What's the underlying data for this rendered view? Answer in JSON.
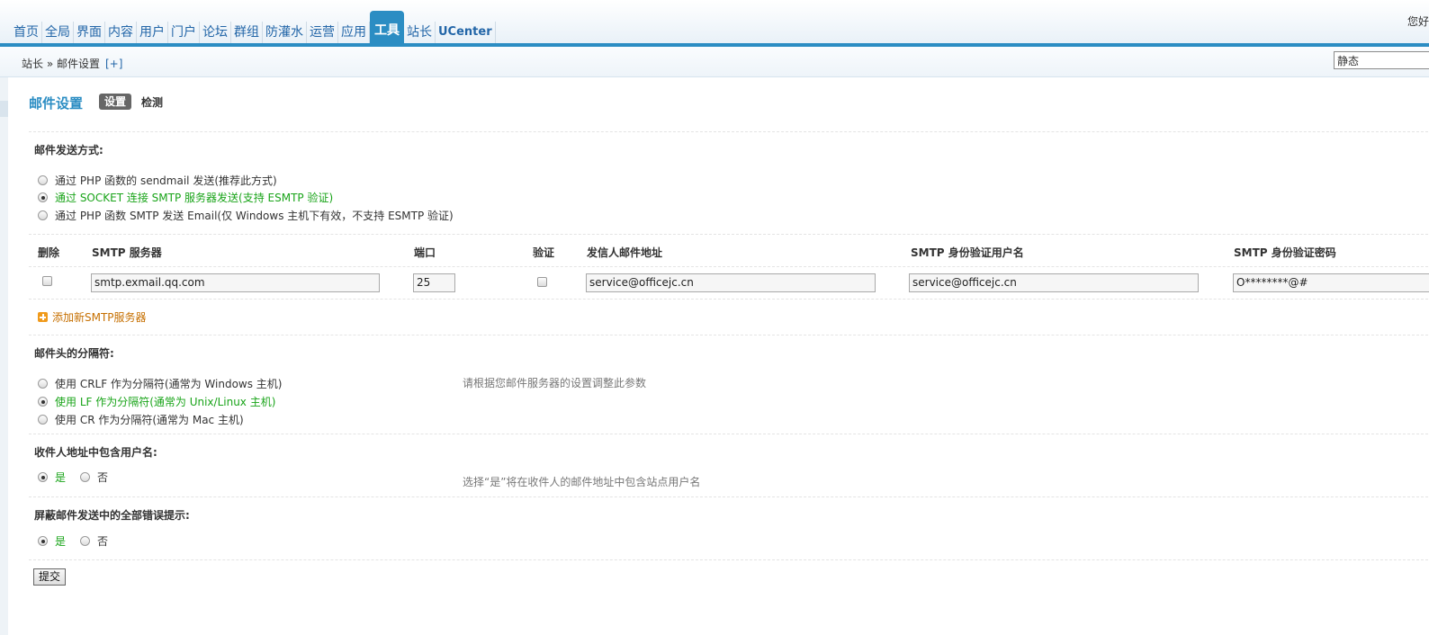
{
  "nav": {
    "items": [
      "首页",
      "全局",
      "界面",
      "内容",
      "用户",
      "门户",
      "论坛",
      "群组",
      "防灌水",
      "运营",
      "应用",
      "工具",
      "站长",
      "UCenter"
    ],
    "active": "工具",
    "greeting": "您好"
  },
  "breadcrumb": {
    "text": "站长 » 邮件设置",
    "plus": "[+]"
  },
  "mode_select": {
    "value": "静态"
  },
  "page": {
    "title": "邮件设置",
    "tab_settings": "设置",
    "tab_check": "检测"
  },
  "send_method": {
    "title": "邮件发送方式:",
    "options": [
      "通过 PHP 函数的 sendmail 发送(推荐此方式)",
      "通过 SOCKET 连接 SMTP 服务器发送(支持 ESMTP 验证)",
      "通过 PHP 函数 SMTP 发送 Email(仅 Windows 主机下有效，不支持 ESMTP 验证)"
    ],
    "selected_index": 1
  },
  "smtp_table": {
    "headers": {
      "delete": "删除",
      "server": "SMTP 服务器",
      "port": "端口",
      "auth": "验证",
      "from": "发信人邮件地址",
      "user": "SMTP 身份验证用户名",
      "password": "SMTP 身份验证密码"
    },
    "row": {
      "server": "smtp.exmail.qq.com",
      "port": "25",
      "from": "service@officejc.cn",
      "user": "service@officejc.cn",
      "password": "O********@#"
    },
    "add_label": "添加新SMTP服务器"
  },
  "separator": {
    "title": "邮件头的分隔符:",
    "options": [
      "使用 CRLF 作为分隔符(通常为 Windows 主机)",
      "使用 LF 作为分隔符(通常为 Unix/Linux 主机)",
      "使用 CR 作为分隔符(通常为 Mac 主机)"
    ],
    "selected_index": 1,
    "hint": "请根据您邮件服务器的设置调整此参数"
  },
  "include_username": {
    "title": "收件人地址中包含用户名:",
    "yes": "是",
    "no": "否",
    "hint": "选择“是”将在收件人的邮件地址中包含站点用户名"
  },
  "suppress_errors": {
    "title": "屏蔽邮件发送中的全部错误提示:",
    "yes": "是",
    "no": "否"
  },
  "submit_label": "提交",
  "colors": {
    "accent": "#2b8dc3",
    "selected": "#19a419",
    "link": "#2366a8",
    "add": "#c66f00"
  }
}
